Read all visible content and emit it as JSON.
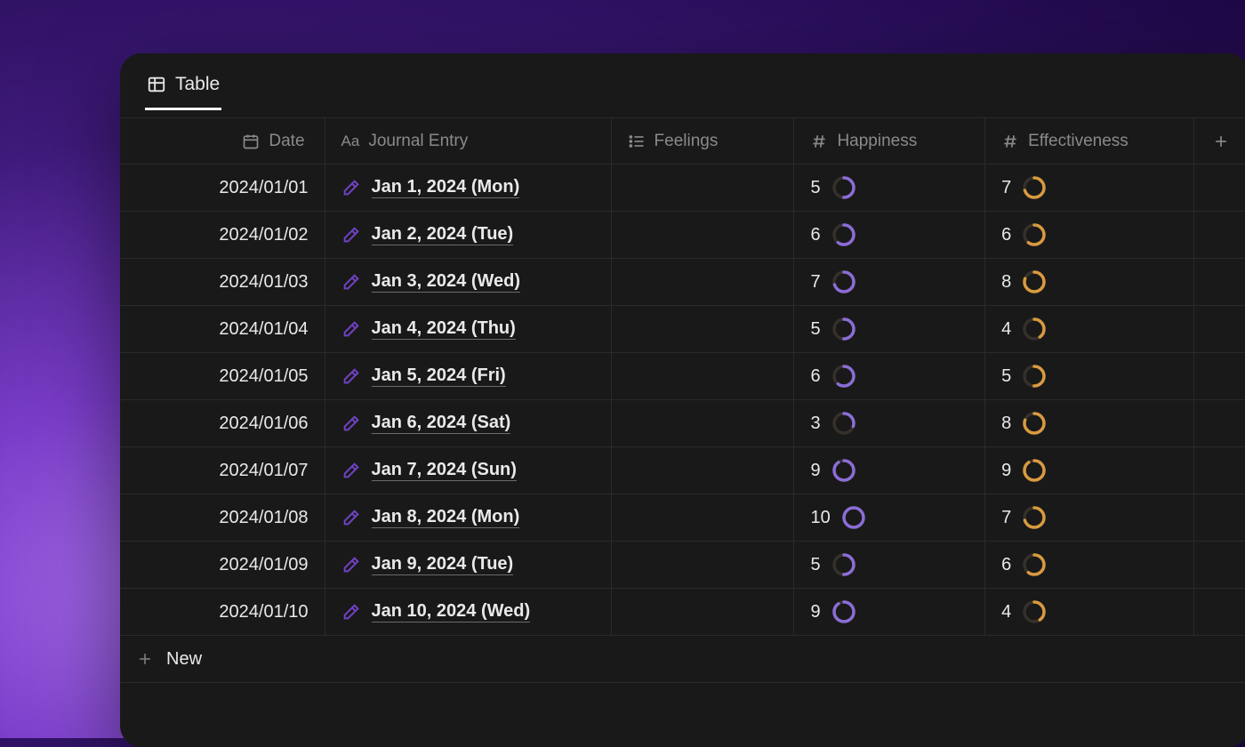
{
  "view_tab": {
    "label": "Table"
  },
  "headers": {
    "date": "Date",
    "entry": "Journal Entry",
    "feelings": "Feelings",
    "happiness": "Happiness",
    "effectiveness": "Effectiveness"
  },
  "ring_max": 10,
  "colors": {
    "happiness_ring": "#8b6dd6",
    "effectiveness_ring": "#d99a3f"
  },
  "rows": [
    {
      "date": "2024/01/01",
      "entry": "Jan 1, 2024 (Mon)",
      "feelings": "",
      "happiness": 5,
      "effectiveness": 7
    },
    {
      "date": "2024/01/02",
      "entry": "Jan 2, 2024 (Tue)",
      "feelings": "",
      "happiness": 6,
      "effectiveness": 6
    },
    {
      "date": "2024/01/03",
      "entry": "Jan 3, 2024 (Wed)",
      "feelings": "",
      "happiness": 7,
      "effectiveness": 8
    },
    {
      "date": "2024/01/04",
      "entry": "Jan 4, 2024 (Thu)",
      "feelings": "",
      "happiness": 5,
      "effectiveness": 4
    },
    {
      "date": "2024/01/05",
      "entry": "Jan 5, 2024 (Fri)",
      "feelings": "",
      "happiness": 6,
      "effectiveness": 5
    },
    {
      "date": "2024/01/06",
      "entry": "Jan 6, 2024 (Sat)",
      "feelings": "",
      "happiness": 3,
      "effectiveness": 8
    },
    {
      "date": "2024/01/07",
      "entry": "Jan 7, 2024 (Sun)",
      "feelings": "",
      "happiness": 9,
      "effectiveness": 9
    },
    {
      "date": "2024/01/08",
      "entry": "Jan 8, 2024 (Mon)",
      "feelings": "",
      "happiness": 10,
      "effectiveness": 7
    },
    {
      "date": "2024/01/09",
      "entry": "Jan 9, 2024 (Tue)",
      "feelings": "",
      "happiness": 5,
      "effectiveness": 6
    },
    {
      "date": "2024/01/10",
      "entry": "Jan 10, 2024 (Wed)",
      "feelings": "",
      "happiness": 9,
      "effectiveness": 4
    }
  ],
  "new_row_label": "New"
}
